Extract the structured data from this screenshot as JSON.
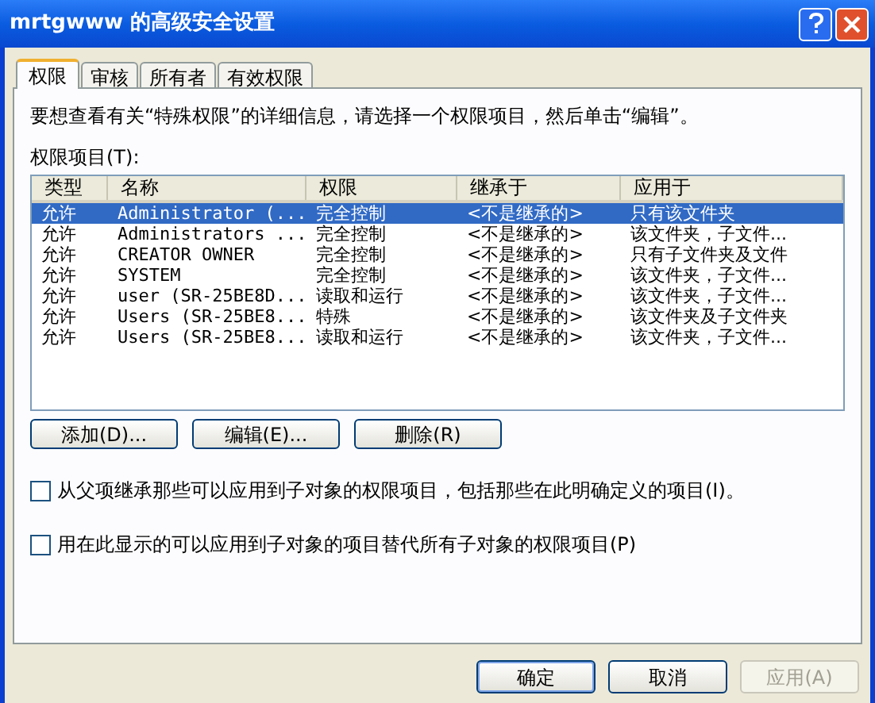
{
  "window": {
    "title": "mrtgwww 的高级安全设置"
  },
  "tabs": [
    {
      "label": "权限",
      "selected": true
    },
    {
      "label": "审核",
      "selected": false
    },
    {
      "label": "所有者",
      "selected": false
    },
    {
      "label": "有效权限",
      "selected": false
    }
  ],
  "intro": "要想查看有关“特殊权限”的详细信息，请选择一个权限项目，然后单击“编辑”。",
  "list_label": "权限项目(T):",
  "table": {
    "columns": [
      "类型",
      "名称",
      "权限",
      "继承于",
      "应用于"
    ],
    "rows": [
      {
        "cells": [
          "允许",
          "Administrator (...",
          "完全控制",
          "<不是继承的>",
          "只有该文件夹"
        ],
        "selected": true
      },
      {
        "cells": [
          "允许",
          "Administrators ...",
          "完全控制",
          "<不是继承的>",
          "该文件夹，子文件..."
        ],
        "selected": false
      },
      {
        "cells": [
          "允许",
          "CREATOR OWNER",
          "完全控制",
          "<不是继承的>",
          "只有子文件夹及文件"
        ],
        "selected": false
      },
      {
        "cells": [
          "允许",
          "SYSTEM",
          "完全控制",
          "<不是继承的>",
          "该文件夹，子文件..."
        ],
        "selected": false
      },
      {
        "cells": [
          "允许",
          "user (SR-25BE8D...",
          "读取和运行",
          "<不是继承的>",
          "该文件夹，子文件..."
        ],
        "selected": false
      },
      {
        "cells": [
          "允许",
          "Users (SR-25BE8...",
          "特殊",
          "<不是继承的>",
          "该文件夹及子文件夹"
        ],
        "selected": false
      },
      {
        "cells": [
          "允许",
          "Users (SR-25BE8...",
          "读取和运行",
          "<不是继承的>",
          "该文件夹，子文件..."
        ],
        "selected": false
      }
    ]
  },
  "list_buttons": [
    "添加(D)...",
    "编辑(E)...",
    "删除(R)"
  ],
  "checkboxes": [
    {
      "label": "从父项继承那些可以应用到子对象的权限项目，包括那些在此明确定义的项目(I)。",
      "checked": false
    },
    {
      "label": "用在此显示的可以应用到子对象的项目替代所有子对象的权限项目(P)",
      "checked": false
    }
  ],
  "dialog_buttons": [
    {
      "label": "确定",
      "disabled": false,
      "default": true
    },
    {
      "label": "取消",
      "disabled": false,
      "default": false
    },
    {
      "label": "应用(A)",
      "disabled": true,
      "default": false
    }
  ]
}
